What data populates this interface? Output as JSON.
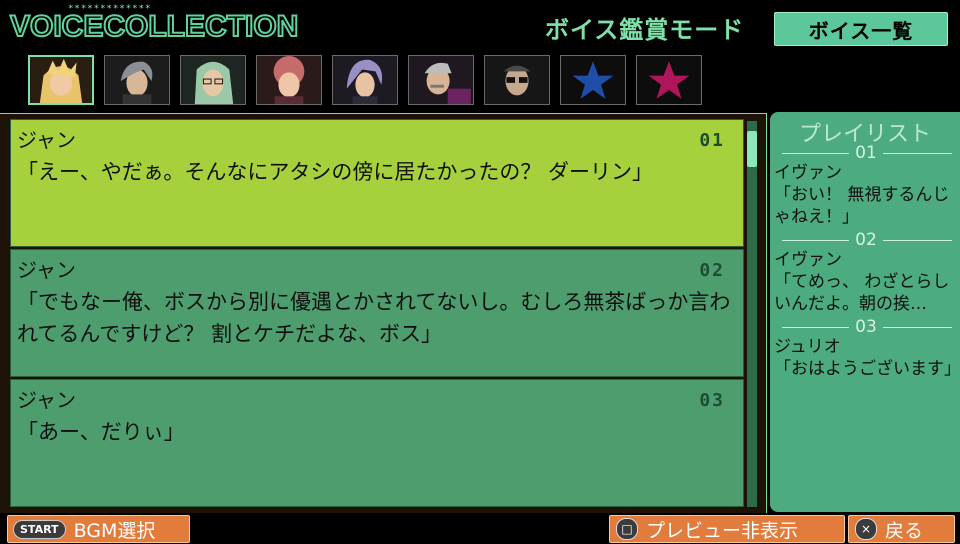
{
  "logo": {
    "text": "VOICECOLLECTION",
    "stars": "*************"
  },
  "header": {
    "mode_title": "ボイス鑑賞モード",
    "list_tab": "ボイス一覧"
  },
  "characters": [
    {
      "name": "character-1",
      "active": true
    },
    {
      "name": "character-2",
      "active": false
    },
    {
      "name": "character-3",
      "active": false
    },
    {
      "name": "character-4",
      "active": false
    },
    {
      "name": "character-5",
      "active": false
    },
    {
      "name": "character-6",
      "active": false
    },
    {
      "name": "character-7",
      "active": false
    },
    {
      "name": "star-blue",
      "active": false
    },
    {
      "name": "star-magenta",
      "active": false
    }
  ],
  "voices": [
    {
      "speaker": "ジャン",
      "number": "01",
      "line": "「えー、やだぁ。そんなにアタシの傍に居たかったの？ ダーリン」"
    },
    {
      "speaker": "ジャン",
      "number": "02",
      "line": "「でもなー俺、ボスから別に優遇とかされてないし。むしろ無茶ばっか言われてるんですけど？ 割とケチだよな、ボス」"
    },
    {
      "speaker": "ジャン",
      "number": "03",
      "line": "「あー、だりぃ」"
    }
  ],
  "playlist": {
    "title": "プレイリスト",
    "items": [
      {
        "number": "01",
        "speaker": "イヴァン",
        "text": "「おい！ 無視するんじゃねえ！」"
      },
      {
        "number": "02",
        "speaker": "イヴァン",
        "text": "「てめっ、 わざとらしいんだよ。朝の挨…"
      },
      {
        "number": "03",
        "speaker": "ジュリオ",
        "text": "「おはようございます」"
      }
    ]
  },
  "footer": {
    "start_icon": "START",
    "bgm_label": "BGM選択",
    "square_icon": "□",
    "preview_label": "プレビュー非表示",
    "cross_icon": "×",
    "back_label": "戻る"
  },
  "colors": {
    "selected_entry": "#a6d13c",
    "entry": "#4d9d6f",
    "playlist_bg": "#4cab7f",
    "accent": "#7fe0a8",
    "button": "#e17c3c",
    "star_blue": "#1f4ea8",
    "star_magenta": "#b0155a"
  }
}
